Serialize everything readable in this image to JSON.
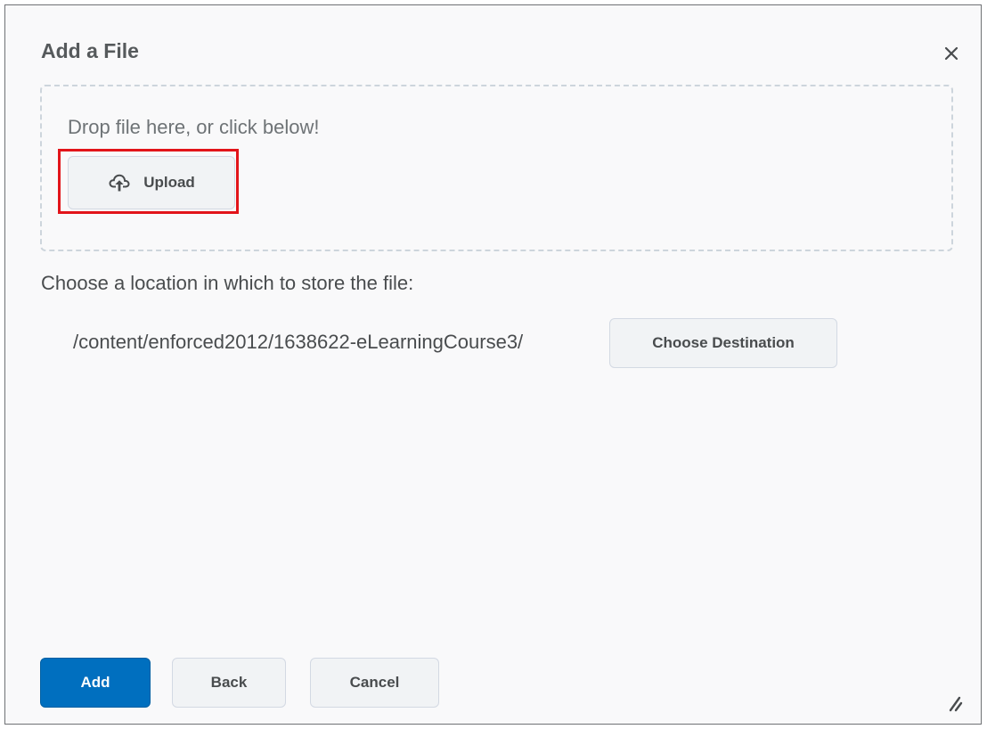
{
  "dialog": {
    "title": "Add a File",
    "close_icon": "close-icon"
  },
  "dropzone": {
    "prompt": "Drop file here, or click below!",
    "upload_label": "Upload",
    "upload_icon": "cloud-upload-icon",
    "highlight_color": "#e2141a"
  },
  "location": {
    "label": "Choose a location in which to store the file:",
    "path": "/content/enforced2012/1638622-eLearningCourse3/",
    "choose_destination_label": "Choose Destination"
  },
  "footer": {
    "add_label": "Add",
    "back_label": "Back",
    "cancel_label": "Cancel",
    "resize_icon": "resize-handle-icon"
  },
  "colors": {
    "primary": "#006fbf",
    "title_text": "#565a5c",
    "body_text": "#494c4e",
    "dialog_bg": "#f9f9fa",
    "dropzone_border": "#cdd5dc"
  }
}
